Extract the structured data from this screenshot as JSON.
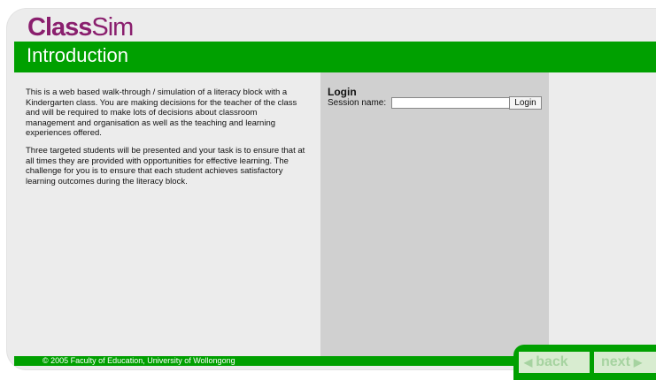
{
  "logo": {
    "bold": "Class",
    "thin": "Sim"
  },
  "page_title": "Introduction",
  "intro": {
    "paragraphs": [
      "This is a web based walk-through / simulation of a literacy block with a Kindergarten class. You are making decisions for the teacher of the class and will be required to make lots of decisions about classroom management and organisation as well as the teaching and learning experiences offered.",
      "Three targeted students will be presented and your task is to ensure that at all times they are provided with opportunities for effective learning. The challenge for you is to ensure that each student achieves satisfactory learning outcomes during the literacy block."
    ]
  },
  "login": {
    "title": "Login",
    "session_label": "Session name:",
    "session_value": "",
    "button_label": "Login"
  },
  "footer": {
    "copyright": "© 2005 Faculty of Education, University of Wollongong"
  },
  "nav": {
    "back_label": "back",
    "next_label": "next",
    "back_arrow": "◀",
    "next_arrow": "▶"
  },
  "colors": {
    "brand_green": "#00a000",
    "logo_purple": "#8a1f6e",
    "panel_gray": "#d0d0d0",
    "frame_gray": "#ececec"
  }
}
